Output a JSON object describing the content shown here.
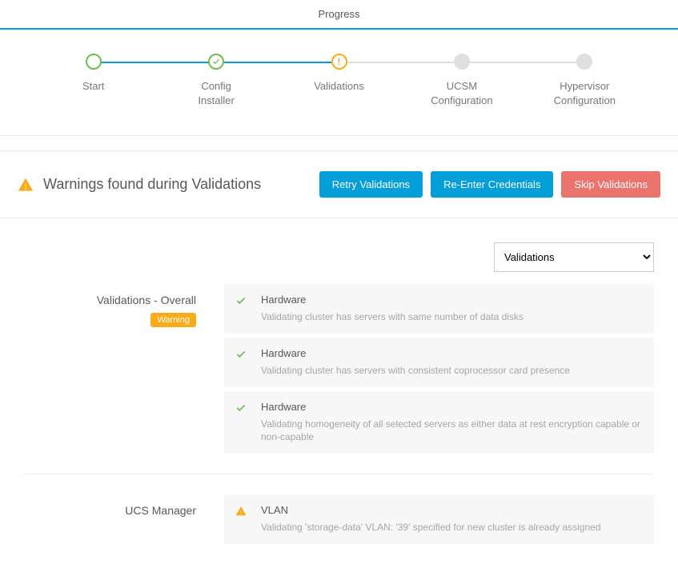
{
  "header": {
    "title": "Progress"
  },
  "stepper": {
    "steps": [
      {
        "label": "Start"
      },
      {
        "label": "Config\nInstaller"
      },
      {
        "label": "Validations"
      },
      {
        "label": "UCSM\nConfiguration"
      },
      {
        "label": "Hypervisor\nConfiguration"
      }
    ]
  },
  "warning_bar": {
    "message": "Warnings found during Validations",
    "actions": {
      "retry": "Retry Validations",
      "reenter": "Re-Enter Credentials",
      "skip": "Skip Validations"
    }
  },
  "dropdown": {
    "selected": "Validations"
  },
  "sections": {
    "overall": {
      "title": "Validations - Overall",
      "badge": "Warning",
      "items": [
        {
          "status": "ok",
          "category": "Hardware",
          "desc": "Validating cluster has servers with same number of data disks"
        },
        {
          "status": "ok",
          "category": "Hardware",
          "desc": "Validating cluster has servers with consistent coprocessor card presence"
        },
        {
          "status": "ok",
          "category": "Hardware",
          "desc": "Validating homogeneity of all selected servers as either data at rest encryption capable or non-capable"
        }
      ]
    },
    "ucs": {
      "title": "UCS Manager",
      "items": [
        {
          "status": "warn",
          "category": "VLAN",
          "desc": "Validating 'storage-data' VLAN: '39' specified for new cluster is already assigned"
        }
      ]
    }
  }
}
